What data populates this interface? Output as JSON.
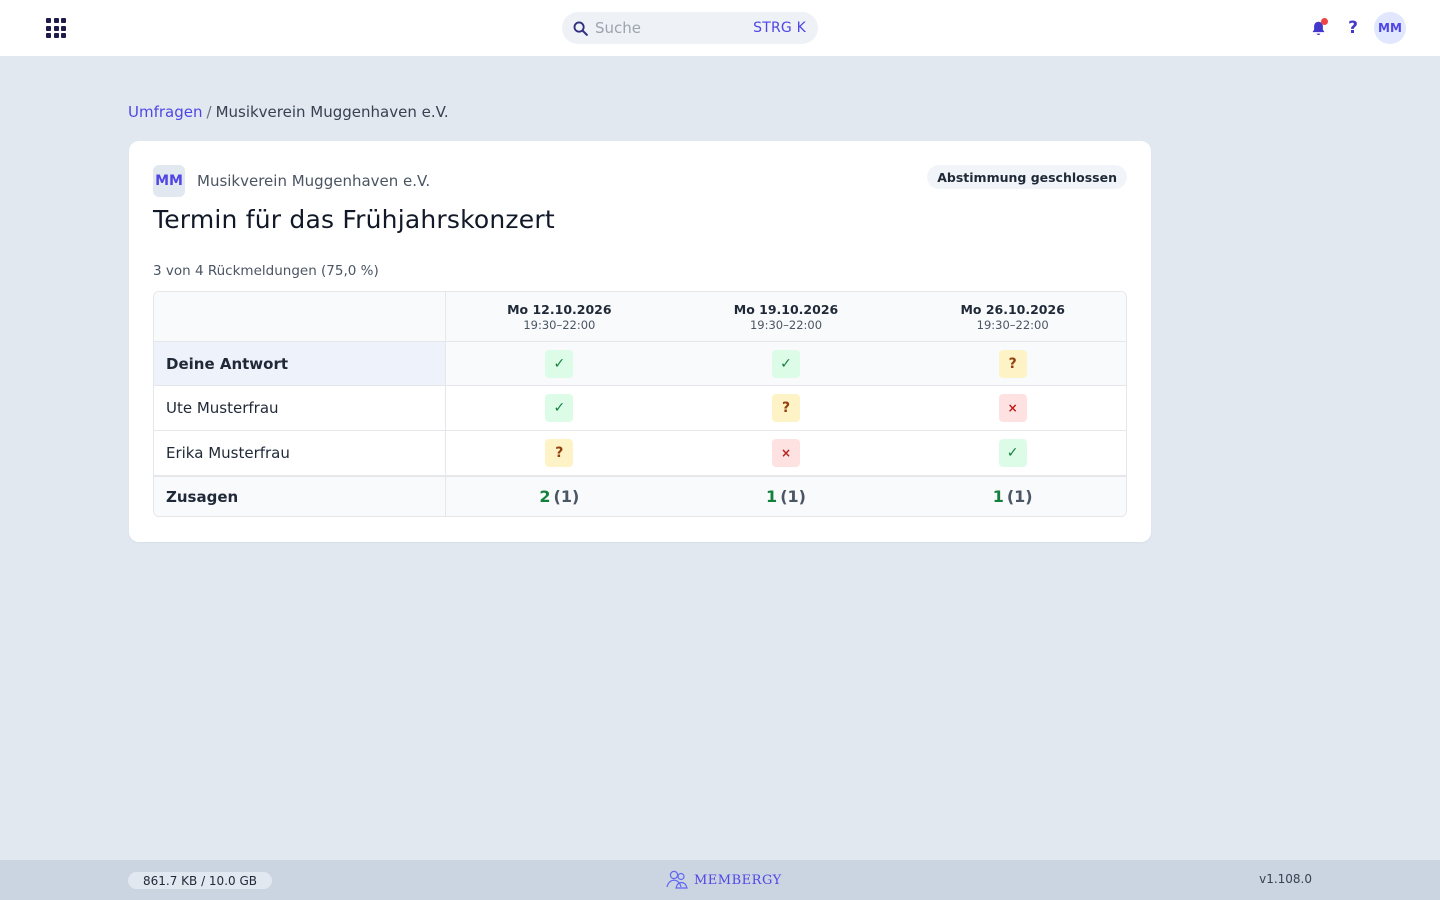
{
  "header": {
    "search": {
      "placeholder": "Suche",
      "shortcut": "STRG K"
    },
    "user_initials": "MM",
    "help_label": "?",
    "icons": {
      "apps": "apps-grid-icon",
      "search": "search-icon",
      "notifications": "bell-icon"
    }
  },
  "breadcrumb": {
    "root": "Umfragen",
    "separator": "/",
    "current": "Musikverein Muggenhaven e.V."
  },
  "poll": {
    "org_initials": "MM",
    "org_name": "Musikverein Muggenhaven e.V.",
    "status": "Abstimmung geschlossen",
    "title": "Termin für das Frühjahrskonzert",
    "responses": "3 von 4 Rückmeldungen (75,0 %)",
    "dates": [
      {
        "date": "Mo 12.10.2026",
        "time": "19:30–22:00"
      },
      {
        "date": "Mo 19.10.2026",
        "time": "19:30–22:00"
      },
      {
        "date": "Mo 26.10.2026",
        "time": "19:30–22:00"
      }
    ],
    "rows": [
      {
        "name": "Deine Antwort",
        "answers": [
          "✓",
          "✓",
          "?"
        ]
      },
      {
        "name": "Ute Musterfrau",
        "answers": [
          "✓",
          "?",
          "×"
        ]
      },
      {
        "name": "Erika Musterfrau",
        "answers": [
          "?",
          "×",
          "✓"
        ]
      }
    ],
    "totals": {
      "label": "Zusagen",
      "values": [
        {
          "yes": "2",
          "maybe": "(1)"
        },
        {
          "yes": "1",
          "maybe": "(1)"
        },
        {
          "yes": "1",
          "maybe": "(1)"
        }
      ]
    }
  },
  "colors": {
    "accent": "#4f46e5",
    "yes": "#15803d",
    "maybe": "#92400e",
    "no": "#b91c1c"
  },
  "footer": {
    "storage": "861.7 KB / 10.0 GB",
    "brand": "MEMBERGY",
    "version": "v1.108.0"
  }
}
